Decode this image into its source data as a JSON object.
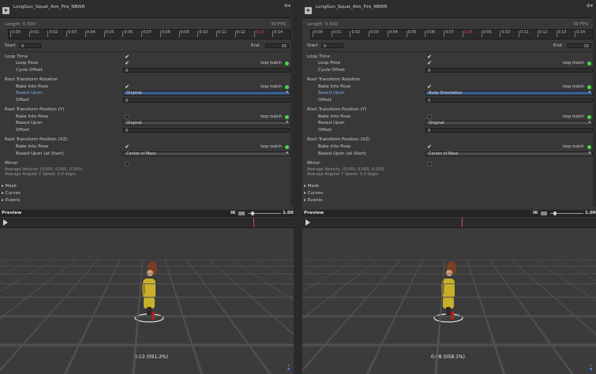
{
  "panels": [
    {
      "id": "left",
      "title": "LongGun_Squat_Aim_Fire_NBWR",
      "length_label": "Length",
      "length_value": "0.500",
      "fps": "30 FPS",
      "ticks": [
        "0:00",
        "0:01",
        "0:02",
        "0:03",
        "0:04",
        "0:05",
        "0:06",
        "0:07",
        "0:08",
        "0:09",
        "0:10",
        "0:11",
        "0:12",
        "0:13",
        "0:14"
      ],
      "current_tick": "0:13",
      "start_label": "Start",
      "start_value": "0",
      "end_label": "End",
      "end_value": "15",
      "loop_time_label": "Loop Time",
      "loop_pose_label": "Loop Pose",
      "cycle_offset_label": "Cycle Offset",
      "cycle_offset_value": "0",
      "loop_match_label": "loop match",
      "rot_header": "Root Transform Rotation",
      "rot_bake_label": "Bake Into Pose",
      "rot_based_label": "Based Upon",
      "rot_based_value": "Original",
      "rot_offset_label": "Offset",
      "rot_offset_value": "0",
      "posy_header": "Root Transform Position (Y)",
      "posy_bake_label": "Bake Into Pose",
      "posy_based_label": "Based Upon",
      "posy_based_value": "Original",
      "posy_offset_label": "Offset",
      "posy_offset_value": "0",
      "posxz_header": "Root Transform Position (XZ)",
      "posxz_bake_label": "Bake Into Pose",
      "posxz_based_label": "Based Upon (at Start)",
      "posxz_based_value": "Center of Mass",
      "mirror_label": "Mirror",
      "avg_velocity": "Average Velocity: (0.000, 0.000, 0.000)",
      "avg_angular": "Average Angular Y Speed: 0.0 deg/s",
      "mask_label": "Mask",
      "curves_label": "Curves",
      "events_label": "Events",
      "preview_label": "Preview",
      "ik_label": "IK",
      "speed_value": "1.00",
      "time_info": "0:13 (091.2%)",
      "rot_bake_checked": true,
      "posy_bake_checked": false,
      "posxz_bake_checked": true
    },
    {
      "id": "right",
      "title": "LongGun_Squat_Aim_Fire_NBWR",
      "length_label": "Length",
      "length_value": "0.500",
      "fps": "30 FPS",
      "ticks": [
        "0:00",
        "0:01",
        "0:02",
        "0:03",
        "0:04",
        "0:05",
        "0:06",
        "0:07",
        "0:08",
        "0:09",
        "0:10",
        "0:11",
        "0:12",
        "0:13",
        "0:14"
      ],
      "current_tick": "0:08",
      "start_label": "Start",
      "start_value": "0",
      "end_label": "End",
      "end_value": "15",
      "loop_time_label": "Loop Time",
      "loop_pose_label": "Loop Pose",
      "cycle_offset_label": "Cycle Offset",
      "cycle_offset_value": "0",
      "loop_match_label": "loop match",
      "rot_header": "Root Transform Rotation",
      "rot_bake_label": "Bake Into Pose",
      "rot_based_label": "Based Upon",
      "rot_based_value": "Body Orientation",
      "rot_offset_label": "Offset",
      "rot_offset_value": "0",
      "posy_header": "Root Transform Position (Y)",
      "posy_bake_label": "Bake Into Pose",
      "posy_based_label": "Based Upon",
      "posy_based_value": "Original",
      "posy_offset_label": "Offset",
      "posy_offset_value": "0",
      "posxz_header": "Root Transform Position (XZ)",
      "posxz_bake_label": "Bake Into Pose",
      "posxz_based_label": "Based Upon (at Start)",
      "posxz_based_value": "Center of Mass",
      "mirror_label": "Mirror",
      "avg_velocity": "Average Velocity: (0.000, 0.000, 0.000)",
      "avg_angular": "Average Angular Y Speed: 0.0 deg/s",
      "mask_label": "Mask",
      "curves_label": "Curves",
      "events_label": "Events",
      "preview_label": "Preview",
      "ik_label": "IK",
      "speed_value": "1.00",
      "time_info": "0:08 (058.1%)",
      "rot_bake_checked": true,
      "posy_bake_checked": false,
      "posxz_bake_checked": true
    }
  ],
  "colors": {
    "panel": "#383838",
    "loop_match_dot": "#48d848",
    "highlight_field": "#3a5a8a",
    "timeline_marker": "#d04848"
  },
  "icons": {
    "app": "animation-clip-icon",
    "settings": "gear-icon",
    "expand": "triangle-right-icon",
    "play": "play-icon"
  }
}
